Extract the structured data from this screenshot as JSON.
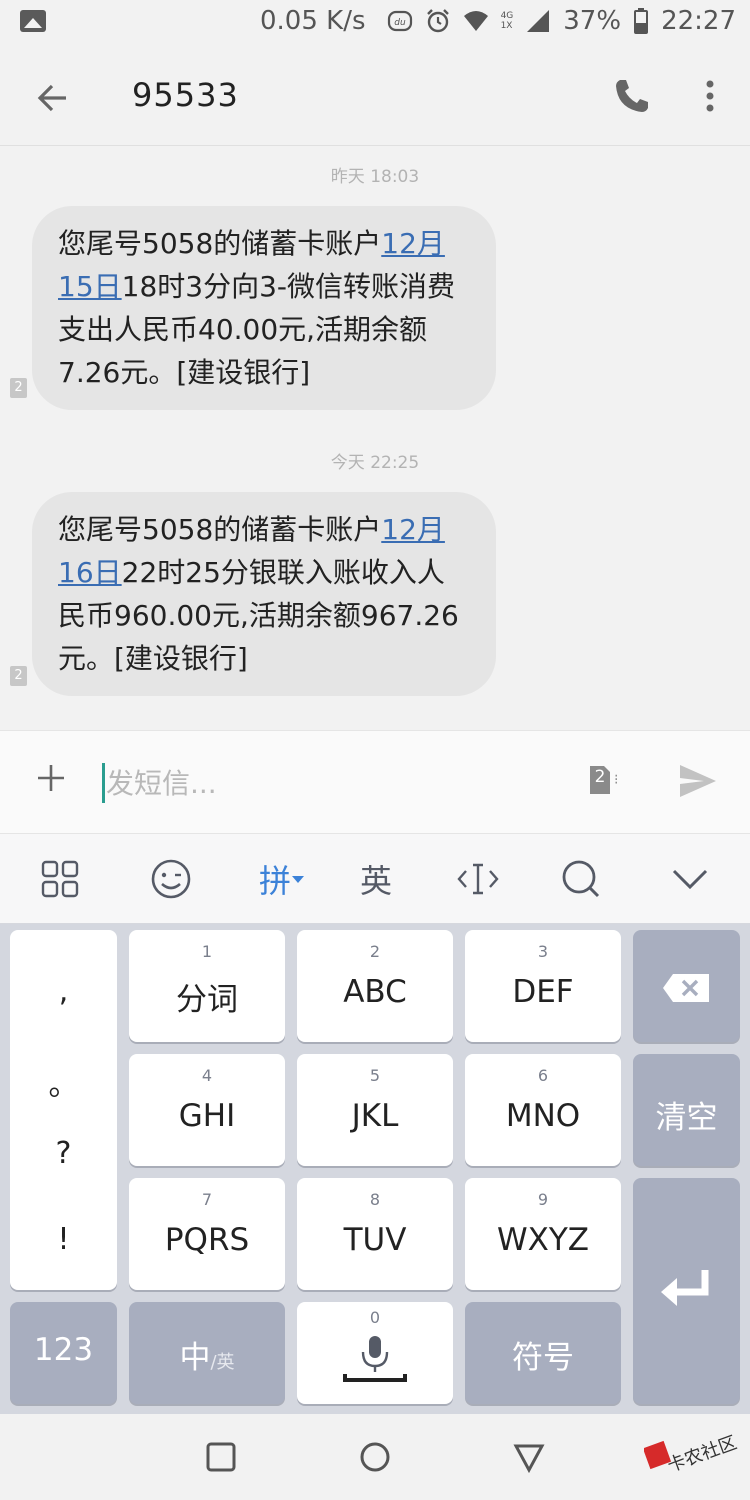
{
  "status_bar": {
    "net_speed": "0.05 K/s",
    "net_type": "4G",
    "net_type2": "1X",
    "battery": "37%",
    "time": "22:27"
  },
  "header": {
    "contact": "95533"
  },
  "messages": [
    {
      "timestamp": "昨天 18:03",
      "text_before": "您尾号5058的储蓄卡账户",
      "link_line1": "12月",
      "link_line2": "15日",
      "text_after": "18时3分向3-微信转账消费支出人民币40.00元,活期余额7.26元。[建设银行]",
      "sim": "2"
    },
    {
      "timestamp": "今天 22:25",
      "text_before": "您尾号5058的储蓄卡账户",
      "link_line1": "12月",
      "link_line2": "16日",
      "text_after": "22时25分银联入账收入人民币960.00元,活期余额967.26元。[建设银行]",
      "sim": "2"
    }
  ],
  "compose": {
    "placeholder": "发短信...",
    "sim": "2"
  },
  "keyboard_toolbar": {
    "pinyin": "拼",
    "english": "英"
  },
  "keyboard": {
    "punct": [
      ",",
      "。",
      "?",
      "!"
    ],
    "keys": [
      {
        "num": "1",
        "label": "分词"
      },
      {
        "num": "2",
        "label": "ABC"
      },
      {
        "num": "3",
        "label": "DEF"
      },
      {
        "num": "4",
        "label": "GHI"
      },
      {
        "num": "5",
        "label": "JKL"
      },
      {
        "num": "6",
        "label": "MNO"
      },
      {
        "num": "7",
        "label": "PQRS"
      },
      {
        "num": "8",
        "label": "TUV"
      },
      {
        "num": "9",
        "label": "WXYZ"
      }
    ],
    "clear": "清空",
    "numbers": "123",
    "lang_main": "中",
    "lang_sub": "/英",
    "zero": "0",
    "symbols": "符号"
  },
  "watermark": "卡农社区",
  "colors": {
    "link": "#3a6db3",
    "accent": "#3c82d8",
    "bubble": "#e5e5e5",
    "key_dark": "#a8aebf"
  }
}
